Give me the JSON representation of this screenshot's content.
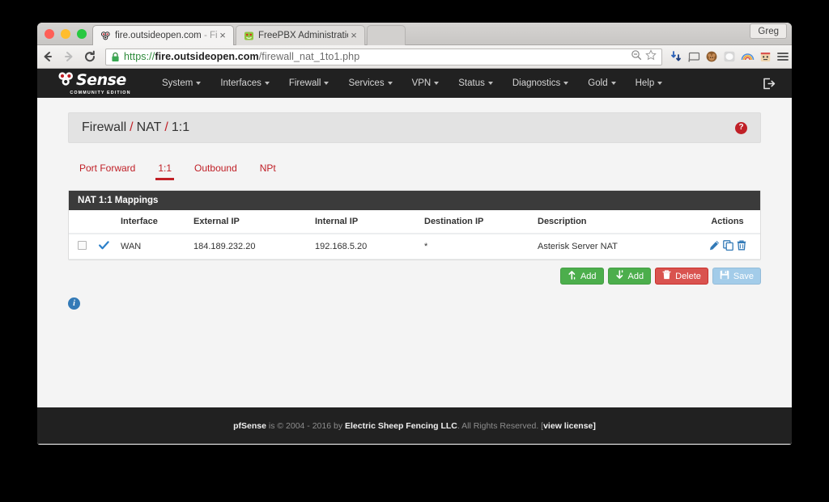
{
  "browser": {
    "tabs": [
      {
        "title_main": "fire.outsideopen.com",
        "title_dim": " - Fire",
        "favicon": "pfsense-favicon",
        "close": "×"
      },
      {
        "title_main": "FreePBX Administration",
        "title_dim": "",
        "favicon": "freepbx-favicon",
        "close": "×"
      }
    ],
    "profile_label": "Greg",
    "nav": {
      "back": "back-arrow",
      "forward": "forward-arrow",
      "reload": "reload-icon"
    },
    "url": {
      "scheme": "https://",
      "host": "fire.outsideopen.com",
      "path": "/firewall_nat_1to1.php",
      "lock": "lock-icon"
    },
    "omnibox_icons": [
      "zoom-out-icon",
      "bookmark-star-icon"
    ],
    "extensions": [
      "downloads-icon",
      "cast-icon",
      "monkey-avatar-icon",
      "cloud-icon",
      "rainbow-icon",
      "robot-icon",
      "menu-icon"
    ]
  },
  "pfsense": {
    "brand": {
      "word": "Sense",
      "prefix_icon": "pfsense-balls-logo",
      "subtitle": "COMMUNITY EDITION"
    },
    "navbar": [
      {
        "label": "System",
        "caret": true
      },
      {
        "label": "Interfaces",
        "caret": true
      },
      {
        "label": "Firewall",
        "caret": true
      },
      {
        "label": "Services",
        "caret": true
      },
      {
        "label": "VPN",
        "caret": true
      },
      {
        "label": "Status",
        "caret": true
      },
      {
        "label": "Diagnostics",
        "caret": true
      },
      {
        "label": "Gold",
        "caret": true
      },
      {
        "label": "Help",
        "caret": true
      }
    ],
    "logout_icon": "logout-icon",
    "breadcrumb": {
      "parts": [
        "Firewall",
        "NAT",
        "1:1"
      ],
      "separator": "/"
    },
    "help_badge": "?",
    "tabs": [
      {
        "label": "Port Forward",
        "active": false
      },
      {
        "label": "1:1",
        "active": true
      },
      {
        "label": "Outbound",
        "active": false
      },
      {
        "label": "NPt",
        "active": false
      }
    ],
    "panel": {
      "heading": "NAT 1:1 Mappings",
      "columns": [
        "",
        "",
        "Interface",
        "External IP",
        "Internal IP",
        "Destination IP",
        "Description",
        "Actions"
      ],
      "rows": [
        {
          "checkbox": false,
          "state_icon": "blue-checkmark-icon",
          "interface": "WAN",
          "external_ip": "184.189.232.20",
          "internal_ip": "192.168.5.20",
          "destination_ip": "*",
          "description": "Asterisk Server NAT",
          "actions": [
            "edit-pencil-icon",
            "copy-icon",
            "delete-trash-icon"
          ]
        }
      ]
    },
    "buttons": [
      {
        "label": "Add",
        "icon": "arrow-up-icon",
        "style": "green"
      },
      {
        "label": "Add",
        "icon": "arrow-down-icon",
        "style": "green"
      },
      {
        "label": "Delete",
        "icon": "trash-icon",
        "style": "red"
      },
      {
        "label": "Save",
        "icon": "floppy-save-icon",
        "style": "blue"
      }
    ],
    "info_badge": "i",
    "footer": {
      "brand": "pfSense",
      "mid": " is © 2004 - 2016 by ",
      "company": "Electric Sheep Fencing LLC",
      "rights": ". All Rights Reserved. [",
      "license": "view license",
      "tail": "]"
    }
  },
  "colors": {
    "accent_red": "#c02027",
    "navbar_dark": "#212121",
    "panel_heading": "#3b3b3b",
    "link_blue": "#337ab7",
    "green": "#4cae4c",
    "danger": "#d9534f"
  }
}
